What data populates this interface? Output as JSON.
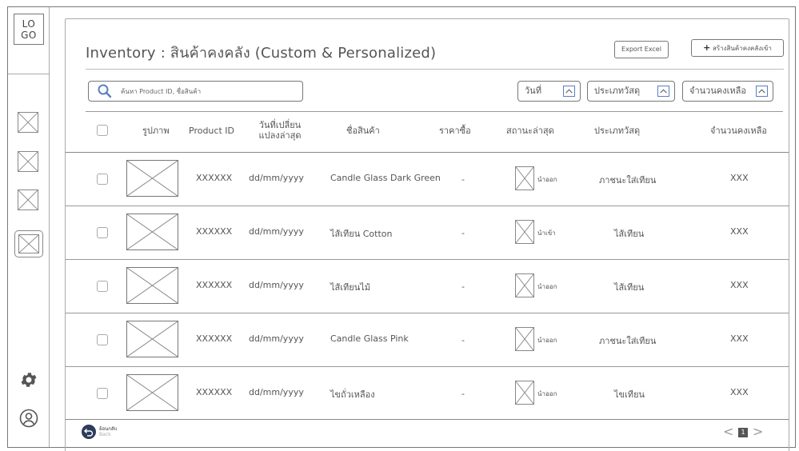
{
  "logo": "LO GO",
  "header": {
    "title": "Inventory : สินค้าคงคลัง (Custom & Personalized)",
    "export_label": "Export Excel",
    "create_label": "สร้างสินค้าคงคลังเข้า",
    "create_prefix": "+"
  },
  "search": {
    "placeholder": "ค้นหา Product ID, ชื่อสินค้า"
  },
  "filters": {
    "date": "วันที่",
    "type": "ประเภทวัสดุ",
    "qty": "จำนวนคงเหลือ"
  },
  "table": {
    "headers": {
      "image": "รูปภาพ",
      "product_id": "Product ID",
      "last_changed_1": "วันที่เปลี่ยน",
      "last_changed_2": "แปลงล่าสุด",
      "name": "ชื่อสินค้า",
      "price": "ราคาซื้อ",
      "status": "สถานะล่าสุด",
      "type": "ประเภทวัสดุ",
      "qty": "จำนวนคงเหลือ"
    },
    "rows": [
      {
        "id": "XXXXXX",
        "date": "dd/mm/yyyy",
        "name": "Candle Glass  Dark Green",
        "price": "-",
        "status": "นำออก",
        "type": "ภาชนะใส่เทียน",
        "qty": "XXX"
      },
      {
        "id": "XXXXXX",
        "date": "dd/mm/yyyy",
        "name": "ไส้เทียน Cotton",
        "price": "-",
        "status": "นำเข้า",
        "type": "ไส้เทียน",
        "qty": "XXX"
      },
      {
        "id": "XXXXXX",
        "date": "dd/mm/yyyy",
        "name": "ไส้เทียนไม้",
        "price": "-",
        "status": "นำออก",
        "type": "ไส้เทียน",
        "qty": "XXX"
      },
      {
        "id": "XXXXXX",
        "date": "dd/mm/yyyy",
        "name": "Candle Glass  Pink",
        "price": "-",
        "status": "นำออก",
        "type": "ภาชนะใส่เทียน",
        "qty": "XXX"
      },
      {
        "id": "XXXXXX",
        "date": "dd/mm/yyyy",
        "name": "ไขถั่วเหลือง",
        "price": "-",
        "status": "นำออก",
        "type": "ไขเทียน",
        "qty": "XXX"
      }
    ]
  },
  "footer": {
    "back_th": "ย้อนกลับ",
    "back_en": "Back",
    "prev": "<",
    "page": "1",
    "next": ">"
  },
  "colors": {
    "accent": "#5a7fc0",
    "back_button": "#2b3d5b"
  },
  "icons": {
    "sidebar": [
      "image-placeholder-icon",
      "image-placeholder-icon",
      "image-placeholder-icon",
      "image-placeholder-icon"
    ],
    "settings": "gear-icon",
    "profile": "user-circle-icon",
    "search": "search-icon",
    "sort": "chevron-up-icon"
  }
}
